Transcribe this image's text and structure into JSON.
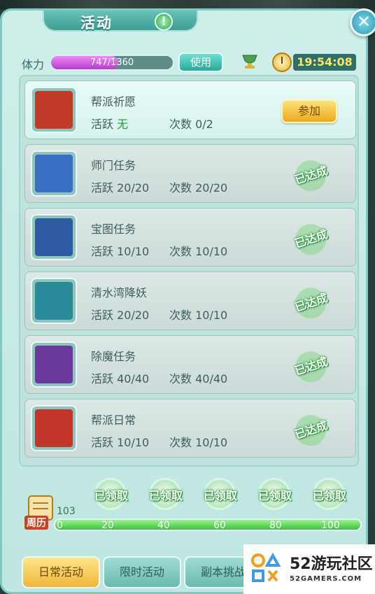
{
  "window": {
    "title": "活动"
  },
  "stamina": {
    "label": "体力",
    "value": "747/1360",
    "fraction": 0.549,
    "use_label": "使用"
  },
  "clock": {
    "time": "19:54:08"
  },
  "activities": [
    {
      "name": "帮派祈愿",
      "active_label": "活跃",
      "active_value": "无",
      "count_label": "次数",
      "count_value": "0/2",
      "action": "参加",
      "status": "active"
    },
    {
      "name": "师门任务",
      "active_label": "活跃",
      "active_value": "20/20",
      "count_label": "次数",
      "count_value": "20/20",
      "action": "已达成",
      "status": "done"
    },
    {
      "name": "宝图任务",
      "active_label": "活跃",
      "active_value": "10/10",
      "count_label": "次数",
      "count_value": "10/10",
      "action": "已达成",
      "status": "done"
    },
    {
      "name": "清水湾降妖",
      "active_label": "活跃",
      "active_value": "20/20",
      "count_label": "次数",
      "count_value": "10/10",
      "action": "已达成",
      "status": "done"
    },
    {
      "name": "除魔任务",
      "active_label": "活跃",
      "active_value": "40/40",
      "count_label": "次数",
      "count_value": "40/40",
      "action": "已达成",
      "status": "done"
    },
    {
      "name": "帮派日常",
      "active_label": "活跃",
      "active_value": "10/10",
      "count_label": "次数",
      "count_value": "10/10",
      "action": "已达成",
      "status": "done"
    }
  ],
  "weekly": {
    "label": "周历",
    "points": "103",
    "progress_fraction": 1.0,
    "ticks": [
      "0",
      "20",
      "40",
      "60",
      "80",
      "100"
    ],
    "rewards": [
      "已领取",
      "已领取",
      "已领取",
      "已领取",
      "已领取"
    ]
  },
  "tabs": [
    "日常活动",
    "限时活动",
    "副本挑战"
  ],
  "watermark": {
    "title": "52游玩社区",
    "subtitle": "52GAMERS.COM"
  },
  "colors": {
    "accent": "#3e9d93",
    "gold": "#f0b63a",
    "done_green": "#2c9a3c",
    "stamina": "#b63ad1"
  }
}
